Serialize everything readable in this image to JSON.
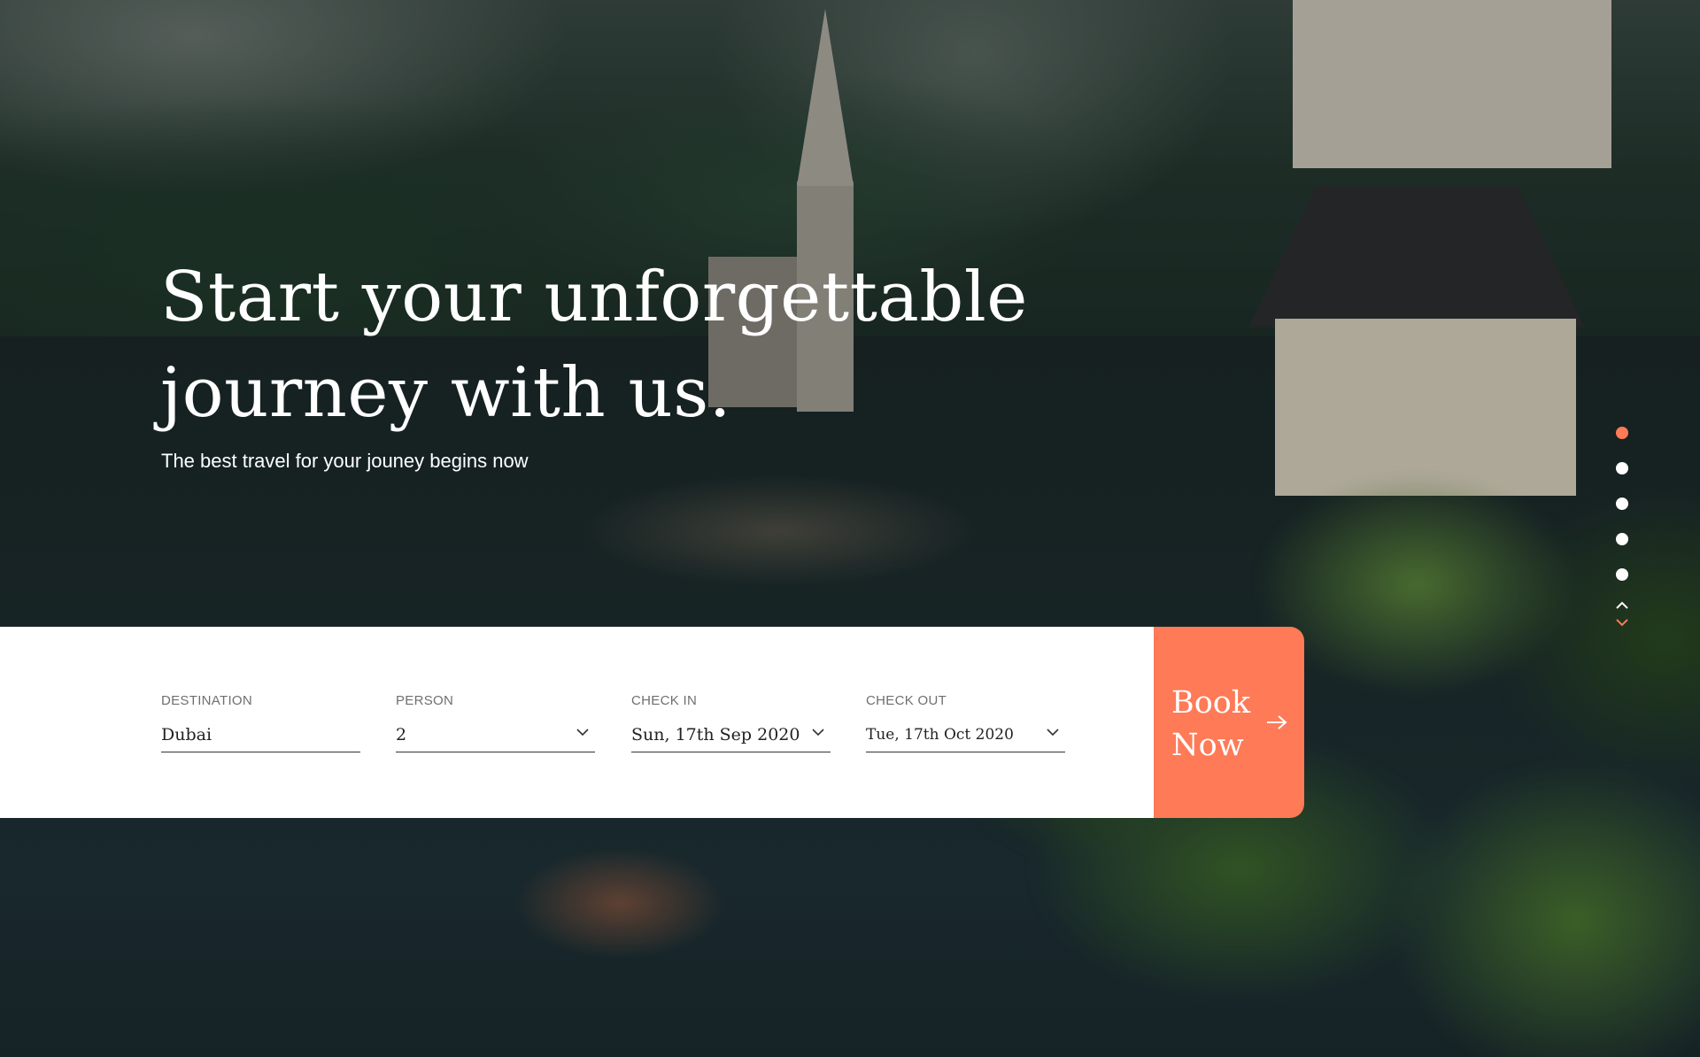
{
  "hero": {
    "title": "Start your unforgettable journey with us.",
    "subtitle": "The best travel for your jouney begins now"
  },
  "slider": {
    "dots": 5,
    "active_index": 0,
    "accent_color": "#ff7a57"
  },
  "booking": {
    "destination": {
      "label": "DESTINATION",
      "value": "Dubai"
    },
    "person": {
      "label": "PERSON",
      "value": "2"
    },
    "check_in": {
      "label": "CHECK IN",
      "value": "Sun, 17th Sep 2020"
    },
    "check_out": {
      "label": "CHECK OUT",
      "value": "Tue, 17th Oct 2020"
    },
    "button_label": "Book Now",
    "button_color": "#ff7a57"
  },
  "icons": {
    "dropdown": "chevron-down-icon",
    "book_arrow": "arrow-right-icon",
    "slider_up": "chevron-up-icon",
    "slider_down": "chevron-down-icon"
  }
}
